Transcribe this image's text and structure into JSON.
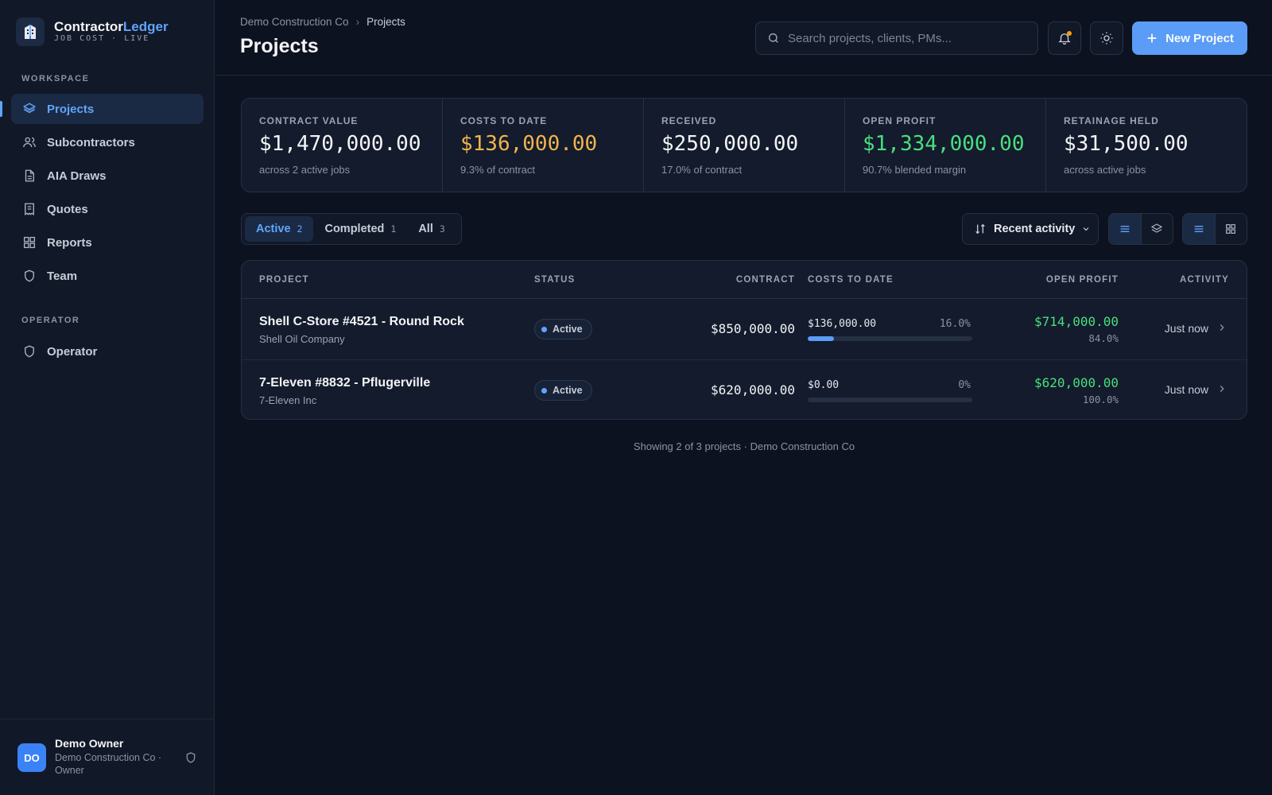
{
  "brand": {
    "name_part1": "Contractor",
    "name_part2": "Ledger",
    "subtitle": "JOB COST · LIVE"
  },
  "sidebar": {
    "workspace_label": "WORKSPACE",
    "items": [
      {
        "label": "Projects",
        "icon": "layers-icon",
        "active": true
      },
      {
        "label": "Subcontractors",
        "icon": "users-icon"
      },
      {
        "label": "AIA Draws",
        "icon": "document-icon"
      },
      {
        "label": "Quotes",
        "icon": "receipt-icon"
      },
      {
        "label": "Reports",
        "icon": "grid-icon"
      },
      {
        "label": "Team",
        "icon": "shield-icon"
      }
    ],
    "operator_label": "OPERATOR",
    "operator_items": [
      {
        "label": "Operator",
        "icon": "shield-icon"
      }
    ]
  },
  "user": {
    "initials": "DO",
    "name": "Demo Owner",
    "org": "Demo Construction Co · Owner"
  },
  "header": {
    "breadcrumb": [
      "Demo Construction Co",
      "Projects"
    ],
    "title": "Projects",
    "search_placeholder": "Search projects, clients, PMs...",
    "new_button": "New Project"
  },
  "stats": [
    {
      "label": "CONTRACT VALUE",
      "value": "$1,470,000.00",
      "sub": "across 2 active jobs",
      "color": "#f3f4f6"
    },
    {
      "label": "COSTS TO DATE",
      "value": "$136,000.00",
      "sub": "9.3% of contract",
      "color": "#f0b44c"
    },
    {
      "label": "RECEIVED",
      "value": "$250,000.00",
      "sub": "17.0% of contract",
      "color": "#f3f4f6"
    },
    {
      "label": "OPEN PROFIT",
      "value": "$1,334,000.00",
      "sub": "90.7% blended margin",
      "color": "#4ade80"
    },
    {
      "label": "RETAINAGE HELD",
      "value": "$31,500.00",
      "sub": "across active jobs",
      "color": "#f3f4f6"
    }
  ],
  "filters": {
    "tabs": [
      {
        "label": "Active",
        "count": "2",
        "active": true
      },
      {
        "label": "Completed",
        "count": "1"
      },
      {
        "label": "All",
        "count": "3"
      }
    ],
    "sort_label": "Recent activity"
  },
  "table": {
    "columns": [
      "PROJECT",
      "STATUS",
      "CONTRACT",
      "COSTS TO DATE",
      "OPEN PROFIT",
      "ACTIVITY"
    ],
    "rows": [
      {
        "name": "Shell C-Store #4521 - Round Rock",
        "client": "Shell Oil Company",
        "status": "Active",
        "contract": "$850,000.00",
        "cost": "$136,000.00",
        "cost_pct": "16.0%",
        "cost_fraction": 0.16,
        "profit": "$714,000.00",
        "profit_pct": "84.0%",
        "activity": "Just now"
      },
      {
        "name": "7-Eleven #8832 - Pflugerville",
        "client": "7-Eleven Inc",
        "status": "Active",
        "contract": "$620,000.00",
        "cost": "$0.00",
        "cost_pct": "0%",
        "cost_fraction": 0,
        "profit": "$620,000.00",
        "profit_pct": "100.0%",
        "activity": "Just now"
      }
    ]
  },
  "footer_note": "Showing 2 of 3 projects · Demo Construction Co",
  "colors": {
    "accent": "#60a5fa",
    "profit": "#4ade80",
    "cost": "#f0b44c",
    "background": "#0d1220"
  }
}
